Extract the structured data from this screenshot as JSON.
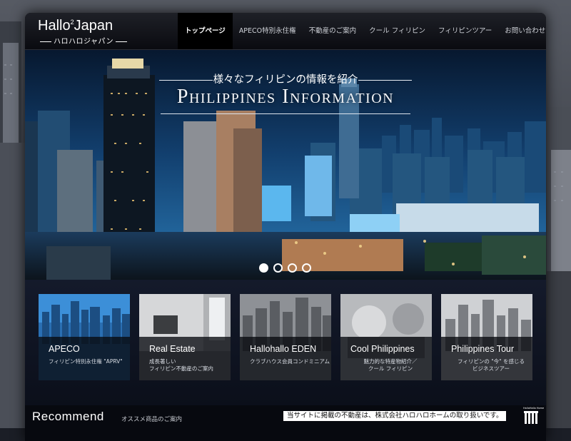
{
  "logo": {
    "main": "Hallo",
    "superscript": "2",
    "main_suffix": "Japan",
    "subtitle": "ハロハロジャパン"
  },
  "nav": {
    "items": [
      {
        "label": "トップページ",
        "active": true
      },
      {
        "label": "APECO特別永住権",
        "active": false
      },
      {
        "label": "不動産のご案内",
        "active": false
      },
      {
        "label": "クール フィリピン",
        "active": false
      },
      {
        "label": "フィリピンツアー",
        "active": false
      },
      {
        "label": "お問い合わせ",
        "active": false
      }
    ]
  },
  "hero": {
    "subtitle": "様々なフィリピンの情報を紹介",
    "title": "Philippines Information",
    "slides": 4,
    "active_slide": 1
  },
  "cards": [
    {
      "title": "APECO",
      "subtitle": "フィリピン特別永住権 \"APRV\""
    },
    {
      "title": "Real Estate",
      "subtitle": "成長著しい\nフィリピン不動産のご案内"
    },
    {
      "title": "Hallohallo EDEN",
      "subtitle": "クラブハウス会員コンドミニアム"
    },
    {
      "title": "Cool Philippines",
      "subtitle": "魅力的な特産物紹介／\nクール フィリピン"
    },
    {
      "title": "Philippines Tour",
      "subtitle": "フィリピンの \"今\" を感じる\nビジネスツアー"
    }
  ],
  "recommend": {
    "title": "Recommend",
    "subtitle": "オススメ商品のご案内",
    "notice": "当サイトに掲載の不動産は、株式会社ハロハロホームの取り扱いです。",
    "partner_logo_text": "HalloHallo Home"
  },
  "colors": {
    "frame_bg": "#07090f",
    "hero_sky_top": "#0d2b55",
    "hero_sky_bottom": "#1d5f9a",
    "card_band": "#141a2b",
    "accent_light": "#7fd4ff"
  }
}
